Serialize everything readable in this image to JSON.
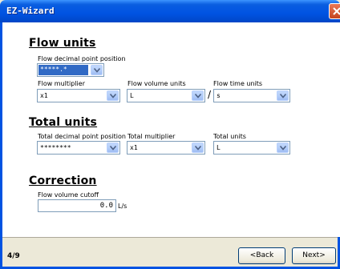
{
  "window": {
    "title": "EZ-Wizard"
  },
  "flow_units": {
    "heading": "Flow units",
    "decimal_point": {
      "label": "Flow decimal point position",
      "value": "*****.*"
    },
    "multiplier": {
      "label": "Flow multiplier",
      "value": "x1"
    },
    "volume_units": {
      "label": "Flow volume units",
      "value": "L"
    },
    "separator": "/",
    "time_units": {
      "label": "Flow time units",
      "value": "s"
    }
  },
  "total_units": {
    "heading": "Total units",
    "decimal_point": {
      "label": "Total decimal point position",
      "value": "********"
    },
    "multiplier": {
      "label": "Total multiplier",
      "value": "x1"
    },
    "units": {
      "label": "Total units",
      "value": "L"
    }
  },
  "correction": {
    "heading": "Correction",
    "cutoff": {
      "label": "Flow volume cutoff",
      "value": "0.0",
      "unit": "L/s"
    }
  },
  "footer": {
    "page_indicator": "4/9",
    "back_label": "<Back",
    "next_label": "Next>"
  }
}
